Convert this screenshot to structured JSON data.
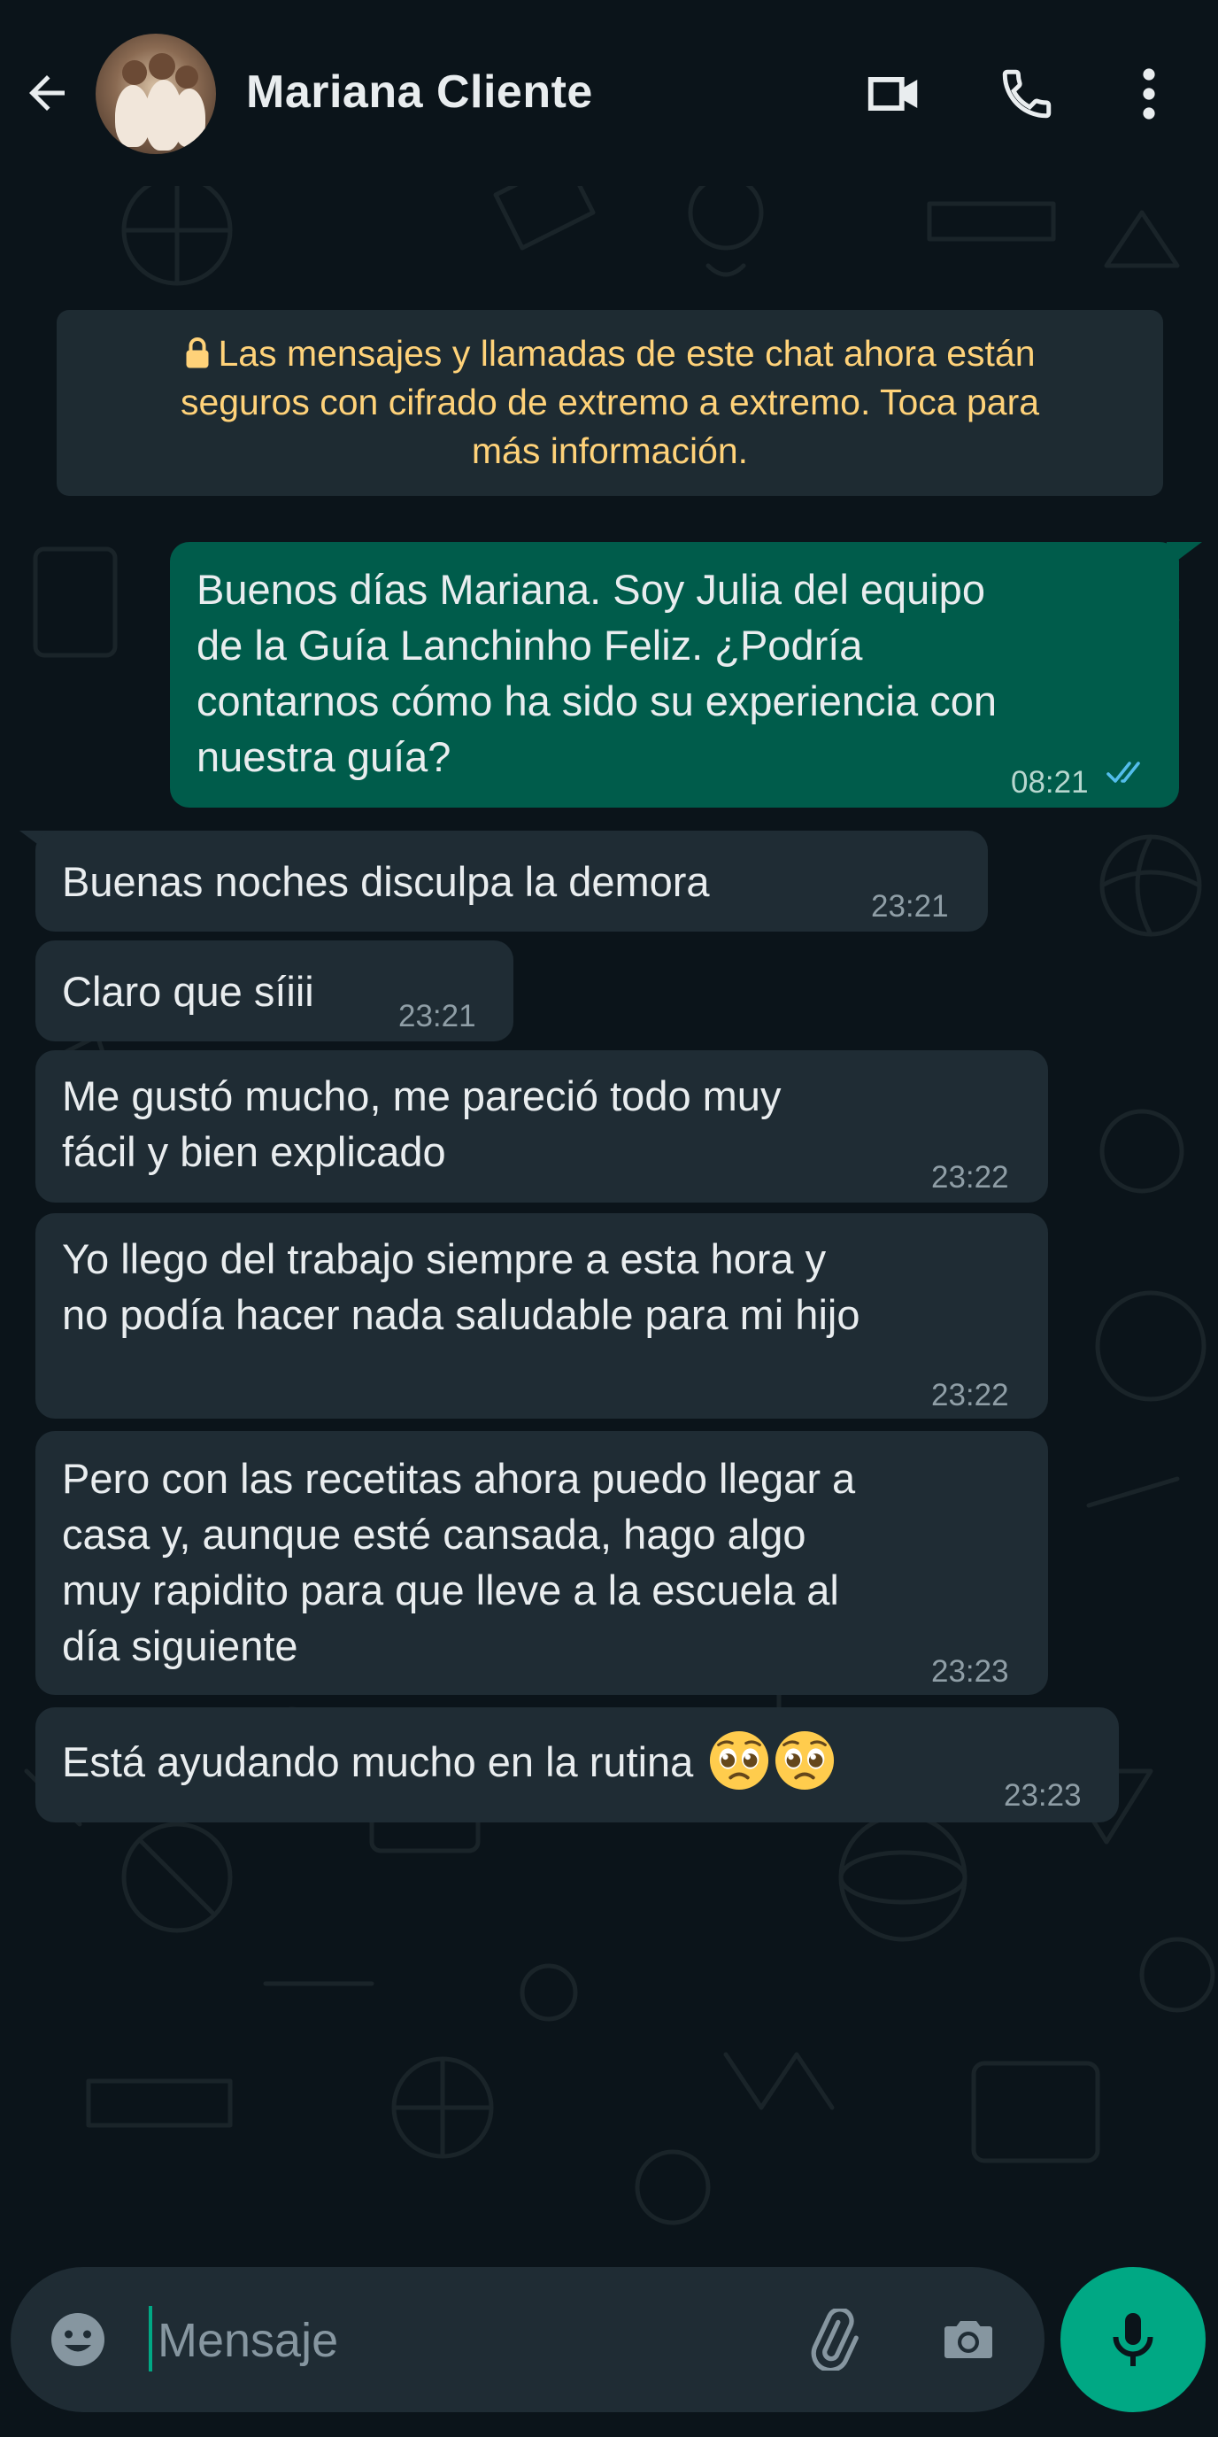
{
  "header": {
    "contact_name": "Mariana Cliente",
    "icons": [
      "back-arrow-icon",
      "video-call-icon",
      "phone-icon",
      "more-vert-icon"
    ]
  },
  "notice": {
    "lock_icon": "lock-icon",
    "line1": "Las mensajes y llamadas de este chat ahora están",
    "line2": "seguros con cifrado de extremo a extremo. Toca para",
    "line3": "más información."
  },
  "messages": [
    {
      "direction": "outgoing",
      "lines": [
        "Buenos días Mariana. Soy Julia del equipo",
        "de la Guía Lanchinho Feliz. ¿Podría",
        "contarnos cómo ha sido su experiencia con",
        "nuestra guía?"
      ],
      "time": "08:21",
      "status": "read"
    },
    {
      "direction": "incoming",
      "lines": [
        "Buenas noches disculpa la demora"
      ],
      "time": "23:21"
    },
    {
      "direction": "incoming",
      "lines": [
        "Claro que síiii"
      ],
      "time": "23:21"
    },
    {
      "direction": "incoming",
      "lines": [
        "Me gustó mucho, me pareció todo muy",
        "fácil y bien explicado"
      ],
      "time": "23:22"
    },
    {
      "direction": "incoming",
      "lines": [
        "Yo llego del trabajo siempre a esta hora y",
        "no podía hacer nada saludable para mi hijo"
      ],
      "time": "23:22"
    },
    {
      "direction": "incoming",
      "lines": [
        "Pero con las recetitas ahora puedo llegar a",
        "casa y, aunque esté cansada, hago algo",
        "muy rapidito para que lleve a la escuela al",
        "día siguiente"
      ],
      "time": "23:23"
    },
    {
      "direction": "incoming",
      "lines": [
        "Está ayudando mucho en la rutina"
      ],
      "emoji": [
        "pleading-face",
        "pleading-face"
      ],
      "time": "23:23"
    }
  ],
  "input": {
    "placeholder": "Mensaje",
    "icons": [
      "emoji-icon",
      "attach-icon",
      "camera-icon",
      "mic-icon"
    ]
  },
  "colors": {
    "background": "#0b141a",
    "incoming_bubble": "#1f2c34",
    "outgoing_bubble": "#005c4b",
    "notice_text": "#ffd279",
    "accent": "#00a884",
    "read_ticks": "#53bdeb"
  }
}
